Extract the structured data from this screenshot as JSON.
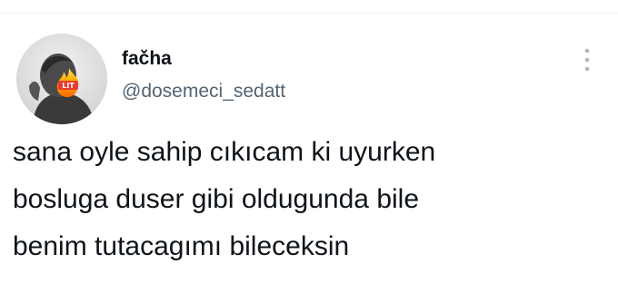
{
  "tweet": {
    "author": {
      "display_name": "fačha",
      "handle": "@dosemeci_sedatt",
      "avatar": {
        "icon": "person-photo-with-lit-fire-emoji",
        "badge_text": "LIT"
      }
    },
    "more_icon": "more-vertical-icon",
    "text_lines": [
      "sana oyle sahip cıkıcam ki uyurken",
      "bosluga duser gibi oldugunda bile",
      "benim tutacagımı bileceksin"
    ]
  },
  "colors": {
    "text_primary": "#0f1419",
    "text_secondary": "#536471",
    "divider": "#eff3f4",
    "more_icon": "#b0b8bf"
  }
}
